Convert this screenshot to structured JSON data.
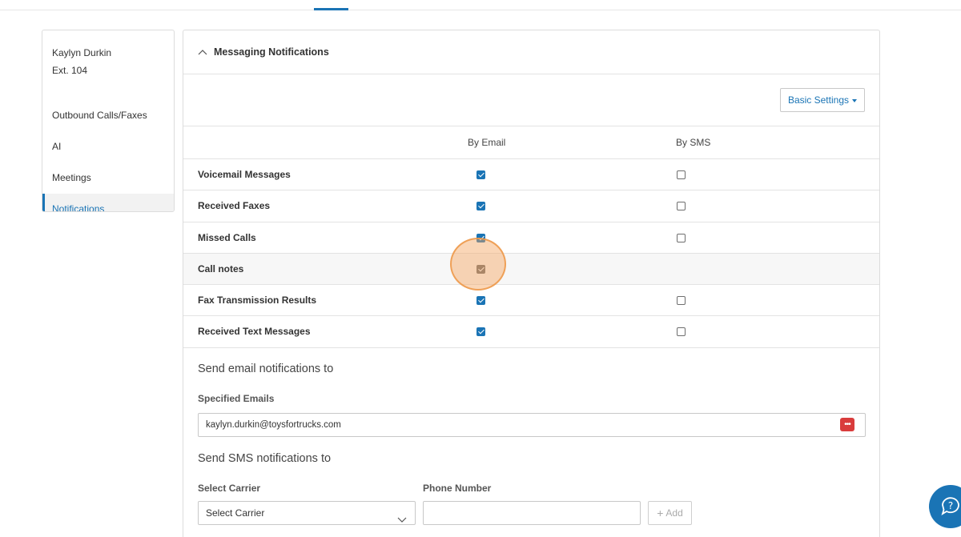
{
  "sidebar": {
    "user_name": "Kaylyn Durkin",
    "user_ext": "Ext. 104",
    "items": [
      {
        "label": "Outbound Calls/Faxes"
      },
      {
        "label": "AI"
      },
      {
        "label": "Meetings"
      },
      {
        "label": "Notifications",
        "active": true
      }
    ]
  },
  "panel": {
    "title": "Messaging Notifications",
    "basic_settings_label": "Basic Settings",
    "columns": {
      "email": "By Email",
      "sms": "By SMS"
    },
    "rows": [
      {
        "label": "Voicemail Messages",
        "email": true,
        "sms": false
      },
      {
        "label": "Received Faxes",
        "email": true,
        "sms": false
      },
      {
        "label": "Missed Calls",
        "email": true,
        "sms": false
      },
      {
        "label": "Call notes",
        "email": true,
        "sms": null
      },
      {
        "label": "Fax Transmission Results",
        "email": true,
        "sms": false
      },
      {
        "label": "Received Text Messages",
        "email": true,
        "sms": false
      }
    ],
    "email_section": {
      "title": "Send email notifications to",
      "field_label": "Specified Emails",
      "value": "kaylyn.durkin@toysfortrucks.com"
    },
    "sms_section": {
      "title": "Send SMS notifications to",
      "carrier_label": "Select Carrier",
      "carrier_value": "Select Carrier",
      "phone_label": "Phone Number",
      "phone_value": "",
      "add_label": "Add"
    }
  },
  "colors": {
    "accent": "#1a74b5",
    "click_highlight": "#f4a460",
    "password_icon": "#d93c3c"
  },
  "icons": {
    "collapse": "chevron-up-icon",
    "dropdown": "caret-down-icon",
    "select": "chevron-down-icon",
    "add": "plus-icon",
    "password_manager": "password-manager-icon",
    "help": "help-chat-icon"
  }
}
